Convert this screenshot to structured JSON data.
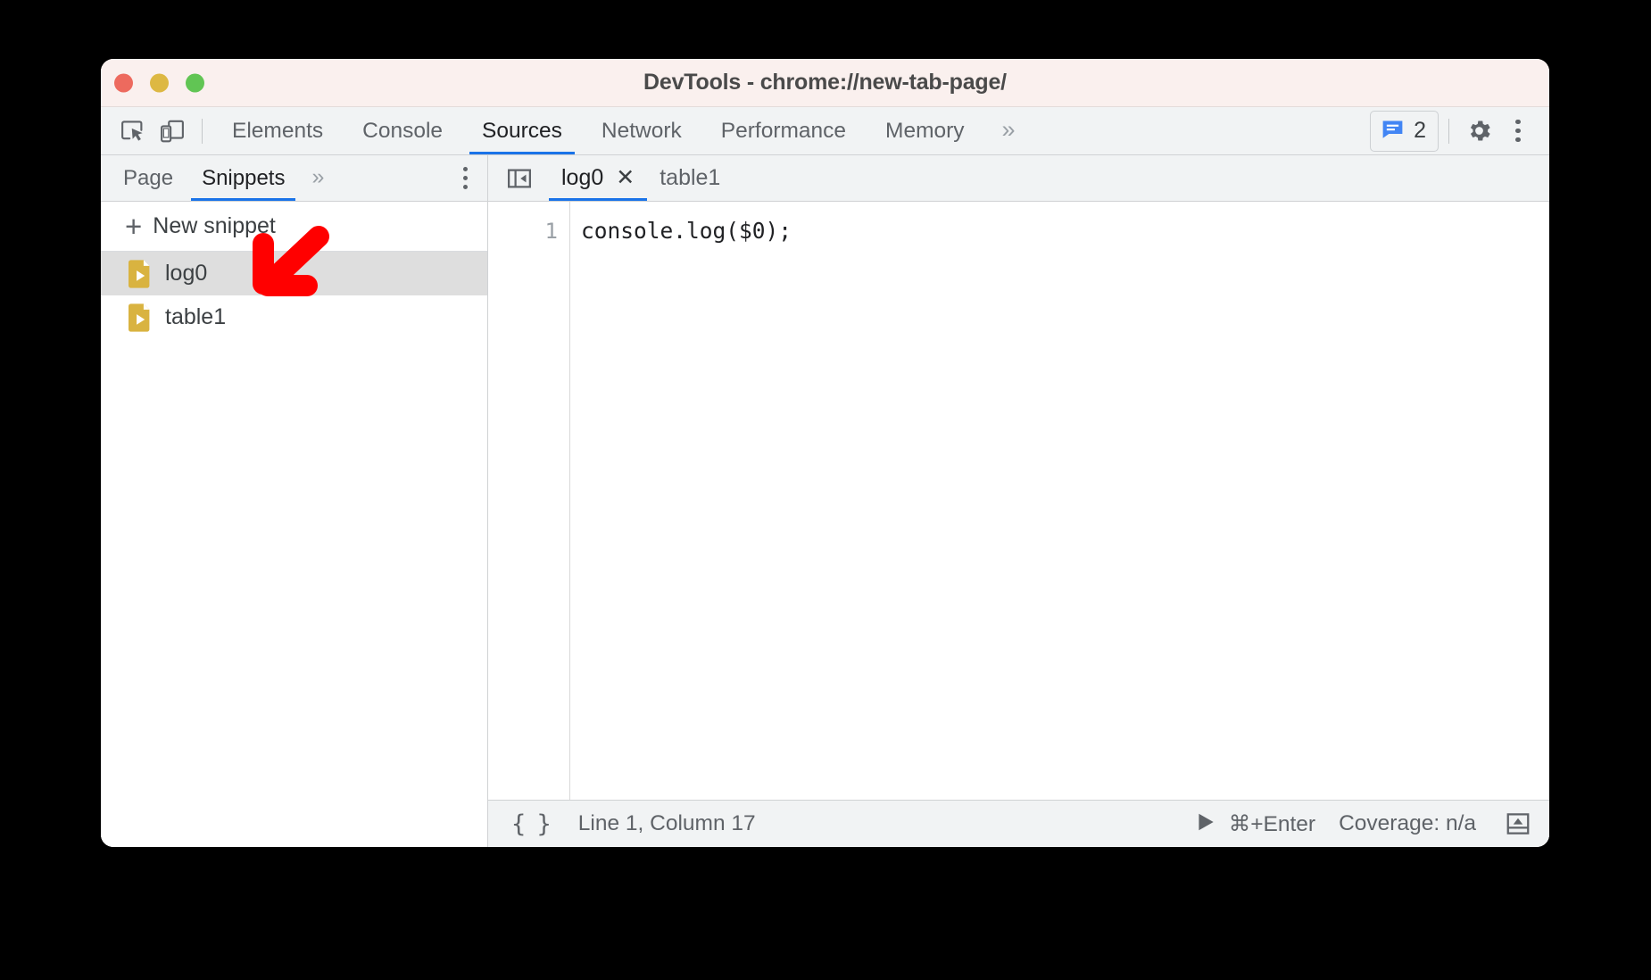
{
  "window": {
    "title": "DevTools - chrome://new-tab-page/",
    "traffic_lights": [
      {
        "name": "close",
        "color": "#ed6a5e"
      },
      {
        "name": "minimize",
        "color": "#ddb843"
      },
      {
        "name": "zoom",
        "color": "#61c554"
      }
    ],
    "titlebar_bg": "#faf0ee"
  },
  "toolbar": {
    "inspect_icon": "inspect-element-icon",
    "device_icon": "device-toolbar-icon",
    "tabs": [
      {
        "label": "Elements",
        "active": false
      },
      {
        "label": "Console",
        "active": false
      },
      {
        "label": "Sources",
        "active": true
      },
      {
        "label": "Network",
        "active": false
      },
      {
        "label": "Performance",
        "active": false
      },
      {
        "label": "Memory",
        "active": false
      }
    ],
    "more_tabs": "»",
    "issues": {
      "icon": "issues-message-icon",
      "count": "2",
      "color": "#4285f4"
    },
    "settings_icon": "gear-icon",
    "menu_icon": "kebab-menu-icon",
    "accent": "#1a73e8"
  },
  "sidebar": {
    "nav_tabs": [
      {
        "label": "Page",
        "active": false
      },
      {
        "label": "Snippets",
        "active": true
      }
    ],
    "more_tabs": "»",
    "menu_icon": "kebab-menu-icon",
    "new_snippet": {
      "plus": "+",
      "label": "New snippet"
    },
    "snippets": [
      {
        "label": "log0",
        "icon": "snippet-file-icon",
        "selected": true
      },
      {
        "label": "table1",
        "icon": "snippet-file-icon",
        "selected": false
      }
    ],
    "snippet_icon_color": "#d9b340",
    "selected_bg": "#dedede"
  },
  "editor": {
    "collapse_icon": "collapse-sidebar-icon",
    "tabs": [
      {
        "label": "log0",
        "active": true,
        "closable": true,
        "close_glyph": "✕"
      },
      {
        "label": "table1",
        "active": false,
        "closable": false,
        "close_glyph": ""
      }
    ],
    "lines": [
      {
        "number": "1",
        "text": "console.log($0);"
      }
    ]
  },
  "status_bar": {
    "format_icon": "pretty-print-braces-icon",
    "format_glyph": "{ }",
    "cursor_position": "Line 1, Column 17",
    "run_icon": "run-play-icon",
    "run_shortcut": "⌘+Enter",
    "coverage": "Coverage: n/a",
    "drawer_icon": "show-drawer-icon"
  },
  "annotation": {
    "arrow": "red-arrow-pointing-down-left",
    "color": "#ff0000"
  }
}
